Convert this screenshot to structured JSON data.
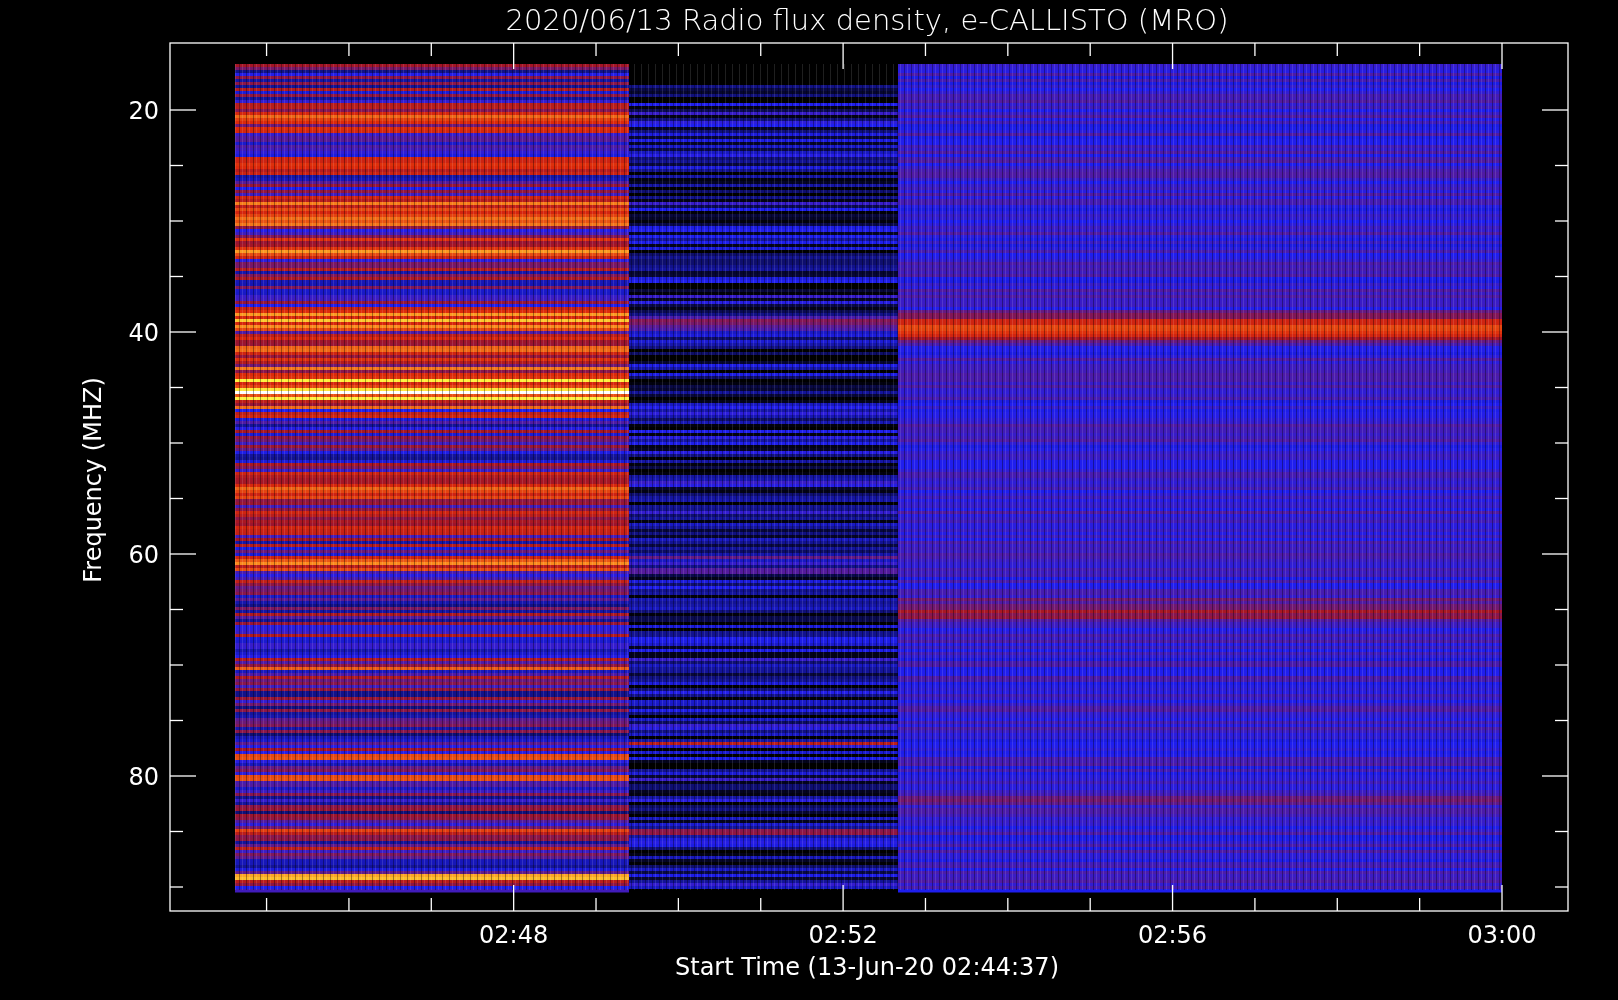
{
  "title": "2020/06/13  Radio flux density, e-CALLISTO (MRO)",
  "y_axis": {
    "label": "Frequency (MHZ)",
    "ticks": [
      "20",
      "40",
      "60",
      "80"
    ]
  },
  "x_axis": {
    "label": "Start Time (13-Jun-20 02:44:37)",
    "ticks": [
      "02:48",
      "02:52",
      "02:56",
      "03:00"
    ]
  }
}
